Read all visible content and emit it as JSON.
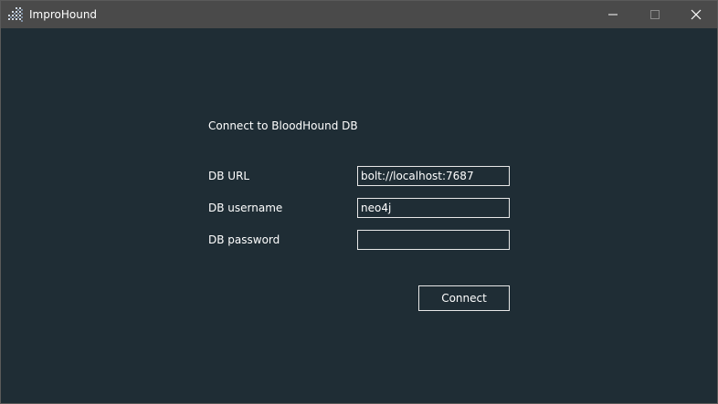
{
  "window": {
    "title": "ImproHound",
    "controls": {
      "minimize": "minimize-icon",
      "maximize": "maximize-icon",
      "close": "close-icon"
    }
  },
  "form": {
    "heading": "Connect to BloodHound DB",
    "url_label": "DB URL",
    "url_value": "bolt://localhost:7687",
    "username_label": "DB username",
    "username_value": "neo4j",
    "password_label": "DB password",
    "password_value": "",
    "connect_label": "Connect"
  },
  "colors": {
    "background": "#1f2d35",
    "titlebar": "#4a4a4a",
    "border": "#e8e8e8",
    "text": "#ffffff"
  }
}
